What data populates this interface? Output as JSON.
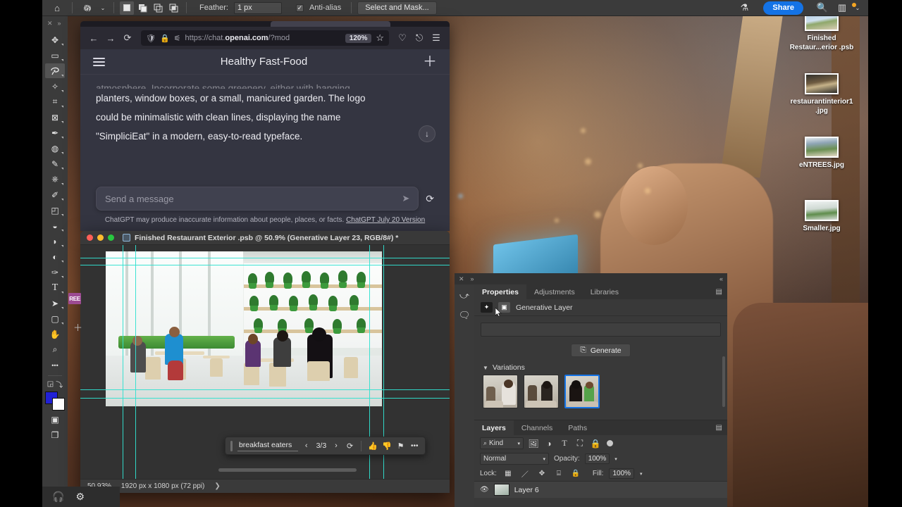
{
  "app": {
    "menubar": {
      "home_icon": "home-icon",
      "tool_preset_icon": "lasso-tool-icon",
      "selection_modes": [
        "new-selection",
        "add-to-selection",
        "subtract-from-selection",
        "intersect-selection"
      ],
      "feather_label": "Feather:",
      "feather_value": "1 px",
      "antialias_label": "Anti-alias",
      "antialias_checked": true,
      "select_and_mask_label": "Select and Mask...",
      "lab_icon": "flask-icon",
      "share_label": "Share",
      "search_icon": "search-icon",
      "workspace_icon": "workspace-icon",
      "chevron_icon": "chevron-down-icon"
    },
    "toolbar": {
      "close_icon": "close-icon",
      "expand_icon": "expand-panel-icon",
      "tools": [
        {
          "name": "move-tool",
          "glyph": "✥"
        },
        {
          "name": "rectangular-marquee-tool",
          "glyph": "▭"
        },
        {
          "name": "lasso-tool",
          "glyph": "𖡎",
          "active": true
        },
        {
          "name": "object-selection-tool",
          "glyph": "✦"
        },
        {
          "name": "crop-tool",
          "glyph": "⌗"
        },
        {
          "name": "frame-tool",
          "glyph": "⊠"
        },
        {
          "name": "eyedropper-tool",
          "glyph": "✒"
        },
        {
          "name": "spot-healing-brush-tool",
          "glyph": "◍"
        },
        {
          "name": "brush-tool",
          "glyph": "✎"
        },
        {
          "name": "clone-stamp-tool",
          "glyph": "⎙"
        },
        {
          "name": "history-brush-tool",
          "glyph": "✐"
        },
        {
          "name": "eraser-tool",
          "glyph": "◨"
        },
        {
          "name": "gradient-tool",
          "glyph": "◧"
        },
        {
          "name": "blur-tool",
          "glyph": "💧"
        },
        {
          "name": "dodge-tool",
          "glyph": "◐"
        },
        {
          "name": "pen-tool",
          "glyph": "✑"
        },
        {
          "name": "type-tool",
          "glyph": "T"
        },
        {
          "name": "path-selection-tool",
          "glyph": "➤"
        },
        {
          "name": "rectangle-tool",
          "glyph": "▢"
        },
        {
          "name": "hand-tool",
          "glyph": "✋"
        },
        {
          "name": "zoom-tool",
          "glyph": "⌕"
        },
        {
          "name": "edit-toolbar-more",
          "glyph": "•••"
        }
      ],
      "free_badge": "REE",
      "quick_mask_icon": "quick-mask-icon",
      "screen_mode_icon": "screen-mode-icon",
      "foreground_color": "#2121d6",
      "background_color": "#ffffff"
    },
    "dock": {
      "headphones_icon": "headphones-icon",
      "settings_icon": "gear-icon"
    }
  },
  "browser": {
    "back_icon": "back-arrow-icon",
    "forward_icon": "forward-arrow-icon",
    "reload_icon": "reload-icon",
    "shield_icon": "shield-icon",
    "lock_icon": "lock-icon",
    "permissions_icon": "permissions-icon",
    "url_prefix": "https://chat.",
    "url_domain": "openai.com",
    "url_suffix": "/?mod",
    "zoom_level": "120%",
    "bookmark_icon": "star-icon",
    "pocket_icon": "pocket-icon",
    "account_icon": "account-icon",
    "menu_icon": "hamburger-menu-icon"
  },
  "chatgpt": {
    "menu_icon": "hamburger-menu-icon",
    "title": "Healthy Fast-Food",
    "new_chat_icon": "plus-icon",
    "message_cut_line": "atmosphere. Incorporate some greenery, either with hanging",
    "message_lines": [
      "planters, window boxes, or a small, manicured garden. The logo",
      "could be minimalistic with clean lines, displaying the name",
      "\"SimpliciEat\" in a modern, easy-to-read typeface."
    ],
    "scroll_down_icon": "arrow-down-icon",
    "composer_placeholder": "Send a message",
    "send_icon": "send-icon",
    "regenerate_icon": "regenerate-icon",
    "disclaimer": "ChatGPT may produce inaccurate information about people, places, or facts.",
    "version_link": "ChatGPT July 20 Version"
  },
  "document": {
    "traffic_lights": [
      "close-button",
      "minimize-button",
      "maximize-button"
    ],
    "file_icon": "psb-file-icon",
    "title": "Finished Restaurant Exterior .psb @ 50.9% (Generative Layer 23, RGB/8#) *",
    "status": {
      "zoom": "50.93%",
      "dimensions": "1920 px x 1080 px (72 ppi)",
      "expand_icon": "chevron-right-icon"
    }
  },
  "genbar": {
    "prompt": "breakfast eaters",
    "prev_icon": "chevron-left-icon",
    "count": "3/3",
    "next_icon": "chevron-right-icon",
    "regenerate_icon": "regenerate-icon",
    "thumbs_up_icon": "thumbs-up-icon",
    "thumbs_down_icon": "thumbs-down-icon",
    "report_icon": "flag-icon",
    "more_icon": "ellipsis-icon"
  },
  "properties_panel": {
    "close_icon": "close-icon",
    "expand_icon": "expand-panel-icon",
    "collapse_icon": "collapse-panel-icon",
    "rail_icons": [
      "history-icon",
      "comments-icon"
    ],
    "tabs": [
      {
        "label": "Properties",
        "active": true
      },
      {
        "label": "Adjustments",
        "active": false
      },
      {
        "label": "Libraries",
        "active": false
      }
    ],
    "menu_icon": "panel-menu-icon",
    "layer_type_icon": "generative-layer-icon",
    "mask_icon": "layer-mask-icon",
    "layer_type_label": "Generative Layer",
    "prompt_value": "",
    "generate_icon": "generate-icon",
    "generate_label": "Generate",
    "variations_label": "Variations",
    "variations_chevron": "chevron-down-icon",
    "variations": [
      {
        "name": "variation-1",
        "selected": false
      },
      {
        "name": "variation-2",
        "selected": false
      },
      {
        "name": "variation-3",
        "selected": true
      }
    ],
    "accent_color": "#1473e6"
  },
  "layers_panel": {
    "tabs": [
      {
        "label": "Layers",
        "active": true
      },
      {
        "label": "Channels",
        "active": false
      },
      {
        "label": "Paths",
        "active": false
      }
    ],
    "menu_icon": "panel-menu-icon",
    "filter_search_icon": "search-icon",
    "filter_kind": "Kind",
    "filter_chevron": "chevron-down-icon",
    "filter_icons": [
      "image-filter-icon",
      "adjustment-filter-icon",
      "type-filter-icon",
      "shape-filter-icon",
      "smart-object-filter-icon"
    ],
    "filter_toggle": "filter-toggle-icon",
    "blend_mode": "Normal",
    "blend_chevron": "chevron-down-icon",
    "opacity_label": "Opacity:",
    "opacity_value": "100%",
    "opacity_chevron": "chevron-down-icon",
    "lock_label": "Lock:",
    "lock_icons": [
      "lock-transparent-pixels-icon",
      "lock-image-pixels-icon",
      "lock-position-icon",
      "lock-artboard-icon",
      "lock-all-icon"
    ],
    "fill_label": "Fill:",
    "fill_value": "100%",
    "fill_chevron": "chevron-down-icon",
    "layers": [
      {
        "visible": true,
        "eye_icon": "eye-icon",
        "name": "Layer 6"
      }
    ]
  },
  "desktop_files": [
    {
      "name": "Finished\nRestaur...erior .psb",
      "label": "Finished Restaur...erior .psb",
      "line1": "Finished",
      "line2": "Restaur...erior .psb"
    },
    {
      "label": "restaurantinterior1 .jpg",
      "line1": "restaurantinterior1",
      "line2": ".jpg"
    },
    {
      "label": "eNTREES.jpg",
      "line1": "eNTREES.jpg",
      "line2": ""
    },
    {
      "label": "Smaller.jpg",
      "line1": "Smaller.jpg",
      "line2": ""
    }
  ]
}
